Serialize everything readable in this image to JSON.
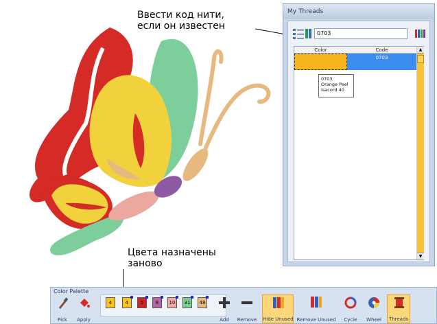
{
  "annotations": {
    "enter_code_line1": "Ввести код нити,",
    "enter_code_line2": "если он известен",
    "reassigned_line1": "Цвета назначены",
    "reassigned_line2": "заново"
  },
  "threads_panel": {
    "title": "My Threads",
    "code_input_value": "0703",
    "columns": [
      "Color",
      "Code"
    ],
    "selected_row": {
      "code": "0703",
      "color": "#f9b51e"
    },
    "tooltip": [
      "0703",
      "Orange Peel",
      "Isacord 40"
    ]
  },
  "palette": {
    "title": "Color Palette",
    "swatches": [
      {
        "label": "4",
        "color": "#f9c41e"
      },
      {
        "label": "4",
        "color": "#f9c41e"
      },
      {
        "label": "5",
        "color": "#d52323"
      },
      {
        "label": "8",
        "color": "#b565a6"
      },
      {
        "label": "10",
        "color": "#f2a7a0"
      },
      {
        "label": "31",
        "color": "#7ccf8e"
      },
      {
        "label": "48",
        "color": "#e8b97f"
      }
    ],
    "buttons": {
      "pick": "Pick",
      "apply": "Apply",
      "add": "Add",
      "remove": "Remove",
      "hide_unused": "Hide Unused",
      "remove_unused": "Remove Unused",
      "cycle": "Cycle",
      "wheel": "Wheel",
      "threads": "Threads"
    }
  },
  "colors": {
    "red": "#d42b26",
    "yellow": "#f2d23c",
    "green": "#7ccf9a",
    "tan": "#e8b97f",
    "pink": "#eaa8a0",
    "purple": "#8e5aa4"
  }
}
